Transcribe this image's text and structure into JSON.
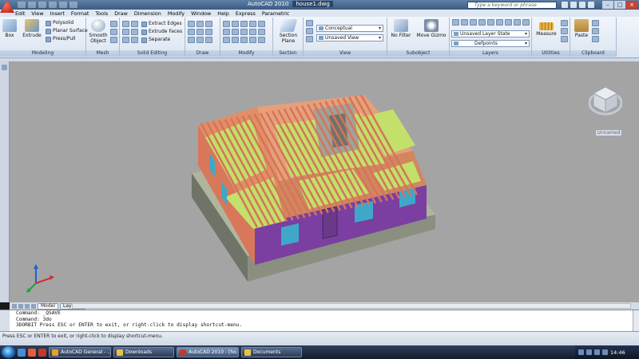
{
  "window": {
    "app_title": "AutoCAD 2010",
    "doc_title": "house1.dwg",
    "search_placeholder": "Type a keyword or phrase"
  },
  "menu": [
    "Edit",
    "View",
    "Insert",
    "Format",
    "Tools",
    "Draw",
    "Dimension",
    "Modify",
    "Window",
    "Help",
    "Express",
    "Parametric"
  ],
  "ribbon": {
    "modeling": {
      "label": "Modeling",
      "box": "Box",
      "extrude": "Extrude",
      "polysolid": "Polysolid",
      "planar_surface": "Planar Surface",
      "press_pull": "Press/Pull"
    },
    "mesh": {
      "label": "Mesh",
      "smooth_object": "Smooth Object"
    },
    "solid_editing": {
      "label": "Solid Editing",
      "extract_edges": "Extract Edges",
      "extrude_faces": "Extrude Faces",
      "separate": "Separate"
    },
    "draw": {
      "label": "Draw"
    },
    "modify": {
      "label": "Modify"
    },
    "section": {
      "label": "Section",
      "section_plane": "Section Plane"
    },
    "view": {
      "label": "View",
      "visual_style": "Conceptual",
      "named_view": "Unsaved View"
    },
    "subobject": {
      "label": "Subobject",
      "no_filter": "No Filter",
      "move_gizmo": "Move Gizmo"
    },
    "layers": {
      "label": "Layers",
      "layer_state": "Unsaved Layer State",
      "current_layer": "Defpoints"
    },
    "utilities": {
      "label": "Utilities",
      "measure": "Measure"
    },
    "clipboard": {
      "label": "Clipboard",
      "paste": "Paste"
    }
  },
  "viewcube": {
    "named_view": "Unnamed"
  },
  "layout_tabs": [
    "Model",
    "Layout1"
  ],
  "command_lines": [
    "Command:  _QSAVE",
    "Command: 3do",
    "3DORBIT Press ESC or ENTER to exit, or right-click to display shortcut-menu."
  ],
  "status_text": "Press ESC or ENTER to exit, or right-click to display shortcut-menu.",
  "taskbar": {
    "tasks": [
      "AutoCAD General - ...",
      "Downloads",
      "AutoCAD 2010 - [ho...",
      "Documents"
    ],
    "clock": "14:46"
  },
  "colors": {
    "ribbon_bg": "#dbe5f1",
    "canvas_bg": "#a4a4a4",
    "wall_purple": "#7b3fa2",
    "wall_salmon": "#d8775a",
    "joist_green": "#c2e06a",
    "window_cyan": "#3fa8c8"
  }
}
